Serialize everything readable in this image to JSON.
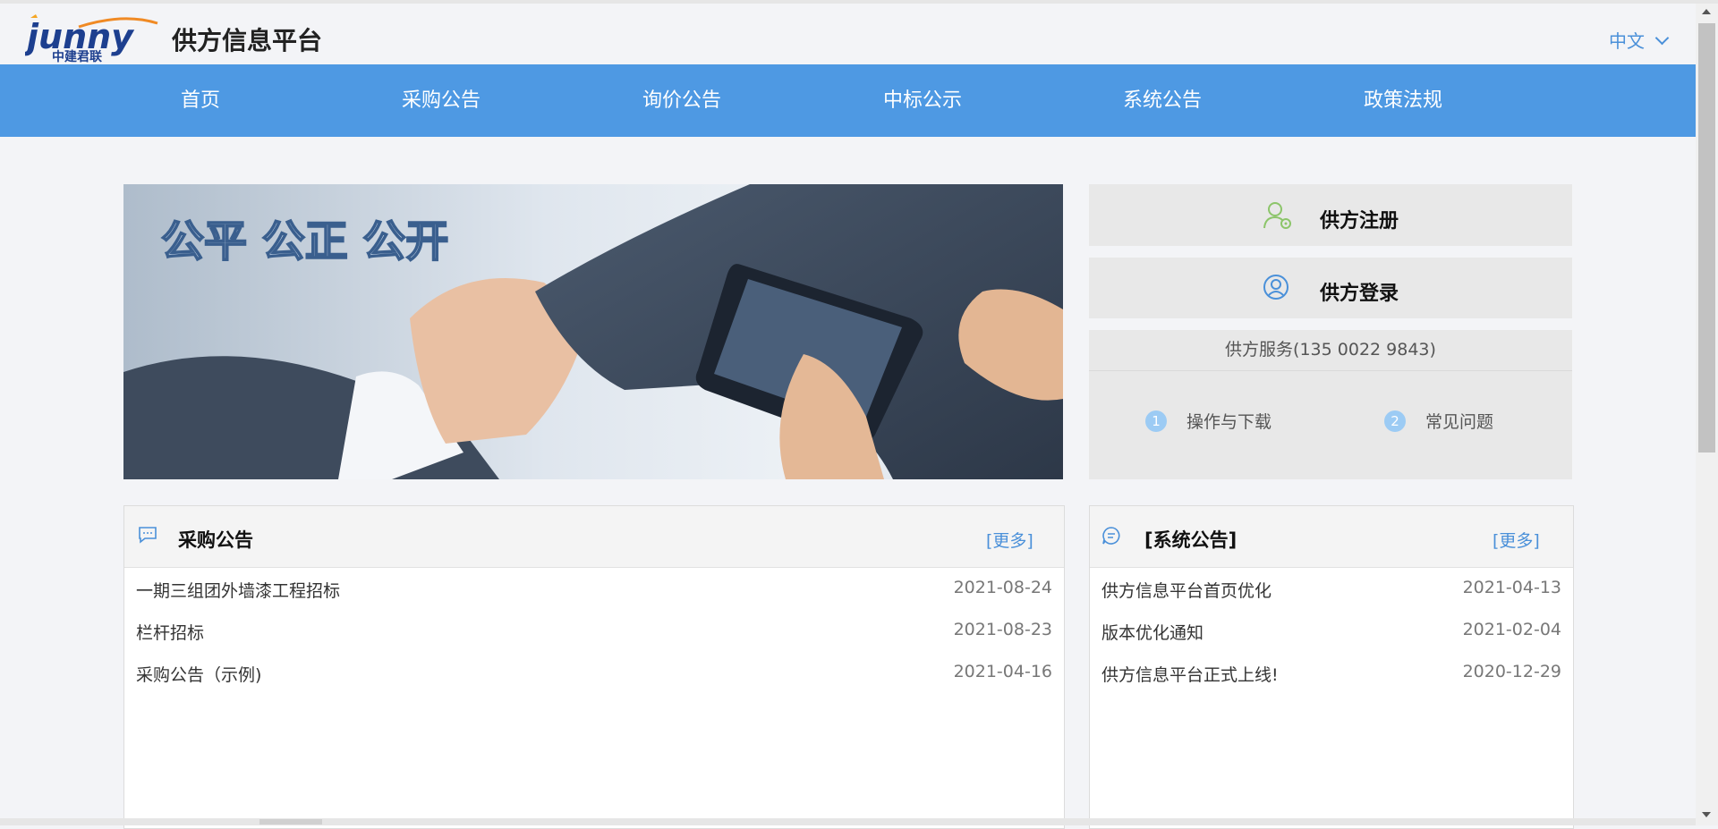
{
  "header": {
    "logo_text": "junny",
    "logo_subtext": "中建君联",
    "site_title": "供方信息平台",
    "language": "中文"
  },
  "nav": {
    "items": [
      {
        "label": "首页"
      },
      {
        "label": "采购公告"
      },
      {
        "label": "询价公告"
      },
      {
        "label": "中标公示"
      },
      {
        "label": "系统公告"
      },
      {
        "label": "政策法规"
      }
    ]
  },
  "banner": {
    "slogan": "公平 公正 公开"
  },
  "side": {
    "register_label": "供方注册",
    "login_label": "供方登录",
    "service_title": "供方服务(135 0022 9843)",
    "links": [
      {
        "num": "1",
        "label": "操作与下载"
      },
      {
        "num": "2",
        "label": "常见问题"
      }
    ]
  },
  "procurement": {
    "title": "采购公告",
    "more_label": "[更多]",
    "rows": [
      {
        "title": "一期三组团外墙漆工程招标",
        "date": "2021-08-24"
      },
      {
        "title": "栏杆招标",
        "date": "2021-08-23"
      },
      {
        "title": "采购公告（示例)",
        "date": "2021-04-16"
      }
    ]
  },
  "system": {
    "title": "[系统公告]",
    "more_label": "[更多]",
    "rows": [
      {
        "title": "供方信息平台首页优化",
        "date": "2021-04-13"
      },
      {
        "title": "版本优化通知",
        "date": "2021-02-04"
      },
      {
        "title": "供方信息平台正式上线!",
        "date": "2020-12-29"
      }
    ]
  },
  "colors": {
    "nav_bg": "#4e99e3",
    "accent": "#4a90d9",
    "panel_bg": "#e8e8e8"
  }
}
